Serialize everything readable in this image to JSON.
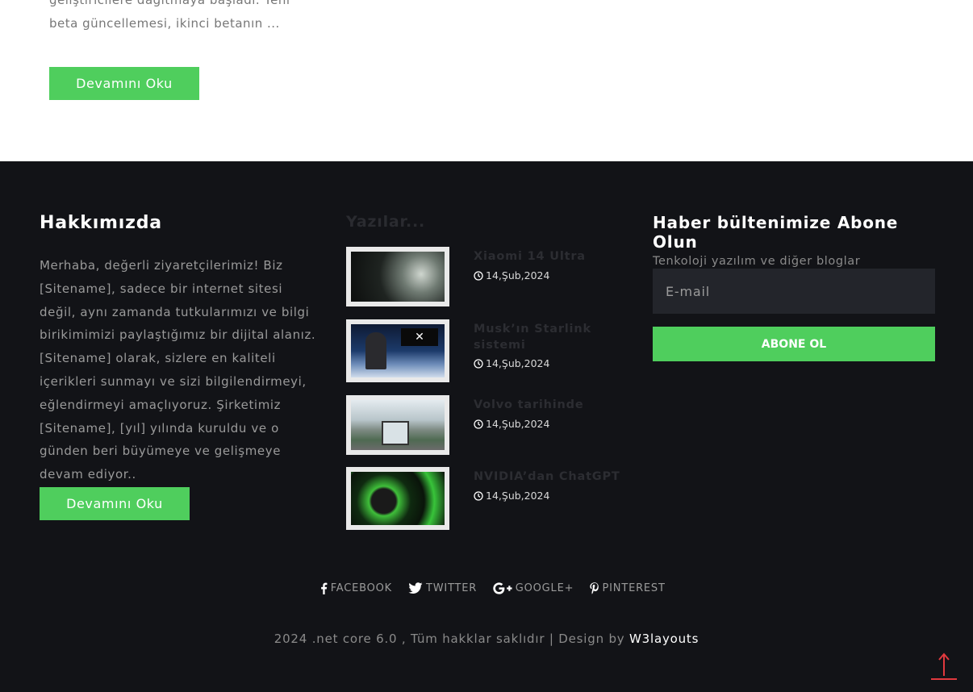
{
  "top": {
    "excerpt": "geliştiricilere dağıtmaya başladı. Yeni beta güncellemesi, ikinci betanın ...",
    "read_more": "Devamını Oku"
  },
  "about": {
    "title": "Hakkımızda",
    "text": "Merhaba, değerli ziyaretçilerimiz! Biz [Sitename], sadece bir internet sitesi değil, aynı zamanda tutkularımızı ve bilgi birikimimizi paylaştığımız bir dijital alanız. [Sitename] olarak, sizlere en kaliteli içerikleri sunmayı ve sizi bilgilendirmeyi, eğlendirmeyi amaçlıyoruz. Şirketimiz [Sitename], [yıl] yılında kuruldu ve o günden beri büyümeye ve gelişmeye devam ediyor..",
    "read_more": "Devamını Oku"
  },
  "posts": {
    "title": "Yazılar...",
    "items": [
      {
        "title": "Xiaomi 14 Ultra",
        "date": "14,Şub,2024"
      },
      {
        "title": "Musk’ın Starlink sistemi",
        "date": "14,Şub,2024"
      },
      {
        "title": "Volvo tarihinde",
        "date": "14,Şub,2024"
      },
      {
        "title": "NVIDIA’dan ChatGPT",
        "date": "14,Şub,2024"
      }
    ]
  },
  "newsletter": {
    "title": "Haber bültenimize Abone Olun",
    "subtitle": "Tenkoloji yazılım ve diğer bloglar",
    "email_placeholder": "E-mail",
    "subscribe": "ABONE OL"
  },
  "social": {
    "facebook": "FACEBOOK",
    "twitter": "TWITTER",
    "google": "GOOGLE+",
    "pinterest": "PINTEREST"
  },
  "footer": {
    "copyright": "2024 .net core 6.0 , Tüm hakklar saklıdır | Design by",
    "brand": "W3layouts"
  },
  "colors": {
    "accent": "#4fce5d",
    "footer_bg": "#121317",
    "scroll_top": "#e0393e"
  }
}
